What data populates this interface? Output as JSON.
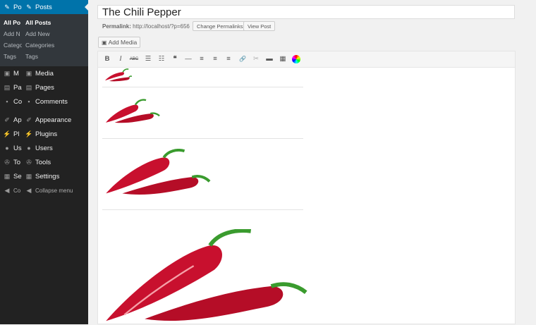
{
  "menu_back": {
    "items": [
      {
        "label": "Po",
        "icon": "pin-icon",
        "active": true
      },
      {
        "label": "M",
        "icon": "media-icon"
      },
      {
        "label": "Pa",
        "icon": "pages-icon"
      },
      {
        "label": "Co",
        "icon": "comments-icon"
      },
      {
        "label": "Ap",
        "icon": "appearance-icon"
      },
      {
        "label": "Pl",
        "icon": "plugins-icon"
      },
      {
        "label": "Us",
        "icon": "users-icon"
      },
      {
        "label": "To",
        "icon": "tools-icon"
      },
      {
        "label": "Se",
        "icon": "settings-icon"
      },
      {
        "label": "Co",
        "icon": "collapse-icon"
      }
    ],
    "sub": [
      "All Po",
      "Add N",
      "Catego",
      "Tags"
    ]
  },
  "menu_front": {
    "posts": "Posts",
    "sub": [
      "All Posts",
      "Add New",
      "Categories",
      "Tags"
    ],
    "media": "Media",
    "pages": "Pages",
    "comments": "Comments",
    "appearance": "Appearance",
    "plugins": "Plugins",
    "users": "Users",
    "tools": "Tools",
    "settings": "Settings",
    "collapse": "Collapse menu"
  },
  "post": {
    "title": "The Chili Pepper",
    "permalink_label": "Permalink:",
    "permalink_url": "http://localhost/?p=656",
    "change_permalinks": "Change Permalinks",
    "view_post": "View Post",
    "add_media": "Add Media"
  },
  "toolbar": {
    "bold": "B",
    "italic": "I",
    "strike": "ABC",
    "bullets": "☰",
    "numbered": "☷",
    "quote": "❝",
    "hr": "—",
    "align_left": "≡",
    "align_center": "≡",
    "align_right": "≡",
    "link": "🔗",
    "unlink": "✂",
    "more": "▬",
    "kitchen_sink": "▦"
  },
  "colors": {
    "admin_bg": "#222222",
    "active": "#0073aa",
    "pepper_red": "#c8102e",
    "stem_green": "#3a9b2e"
  }
}
